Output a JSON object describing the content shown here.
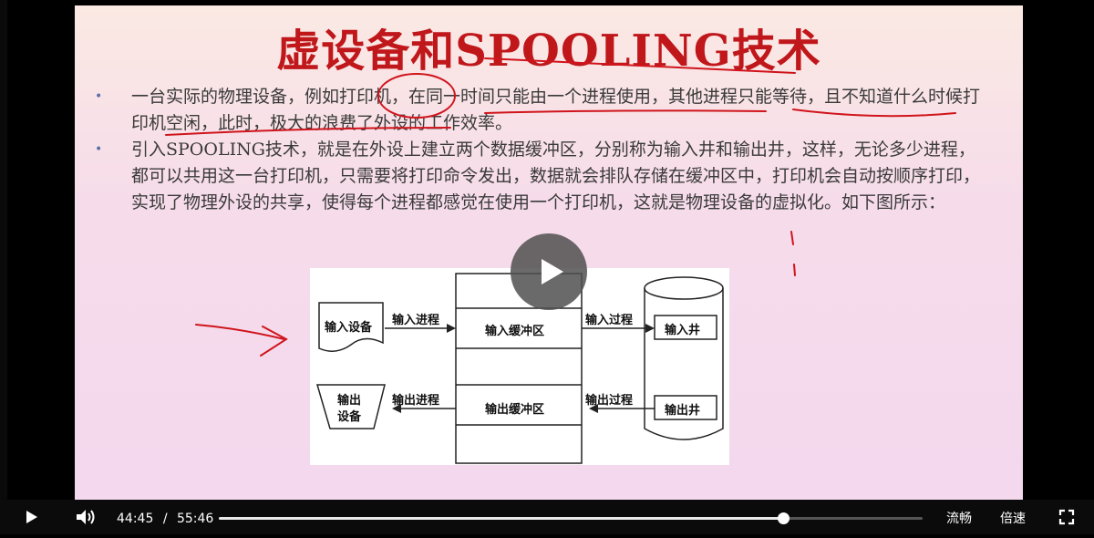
{
  "slide": {
    "title": "虚设备和SPOOLING技术",
    "bullets": [
      "一台实际的物理设备，例如打印机，在同一时间只能由一个进程使用，其他进程只能等待，且不知道什么时候打印机空闲，此时，极大的浪费了外设的工作效率。",
      "引入SPOOLING技术，就是在外设上建立两个数据缓冲区，分别称为输入井和输出井，这样，无论多少进程，都可以共用这一台打印机，只需要将打印命令发出，数据就会排队存储在缓冲区中，打印机会自动按顺序打印，实现了物理外设的共享，使得每个进程都感觉在使用一个打印机，这就是物理设备的虚拟化。如下图所示："
    ],
    "bullet_symbol": "•",
    "diagram": {
      "input_device": "输入设备",
      "input_process": "输入进程",
      "input_buffer": "输入缓冲区",
      "input_process_2": "输入过程",
      "input_well": "输入井",
      "output_device_1": "输出",
      "output_device_2": "设备",
      "output_process": "输出进程",
      "output_buffer": "输出缓冲区",
      "output_process_2": "输出过程",
      "output_well": "输出井"
    }
  },
  "player": {
    "current_time": "44:45",
    "separator": "/",
    "duration": "55:46",
    "progress_fraction": 0.802,
    "quality_label": "流畅",
    "speed_label": "倍速",
    "icons": {
      "play": "play-icon",
      "volume": "volume-icon",
      "fullscreen": "fullscreen-icon",
      "center_play": "play-icon"
    }
  },
  "colors": {
    "title_red": "#c0171b",
    "annotation_red": "#d0141c"
  }
}
